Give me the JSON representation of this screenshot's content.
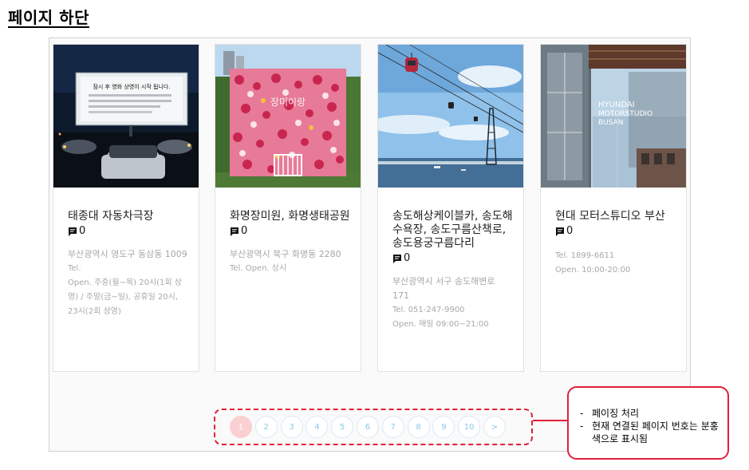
{
  "page": {
    "title": "페이지 하단"
  },
  "cards": [
    {
      "image": "drive-in-theater-photo",
      "name": "태종대 자동차극장",
      "comment_count": "0",
      "address": "부산광역시 영도구 동삼동 1009",
      "info": [
        "Tel.",
        "Open. 주중(월~목) 20시(1회 상영) / 주말(금~일), 공휴일 20시, 23시(2회 상영)"
      ]
    },
    {
      "image": "flower-wall-photo",
      "name": "화명장미원, 화명생태공원",
      "comment_count": "0",
      "address": "부산광역시 북구 화명동 2280",
      "info": [
        "Tel.  Open. 상시"
      ]
    },
    {
      "image": "cable-car-photo",
      "name": "송도해상케이블카, 송도해수욕장, 송도구름산책로, 송도용궁구름다리",
      "comment_count": "0",
      "address": "부산광역시 서구 송도해변로 171",
      "info": [
        "Tel. 051-247-9900",
        "Open. 매일 09:00~21:00"
      ]
    },
    {
      "image": "hyundai-motorstudio-photo",
      "name": "현대 모터스튜디오 부산",
      "comment_count": "0",
      "address": "",
      "info": [
        "Tel. 1899-6611",
        "Open. 10:00-20:00"
      ]
    }
  ],
  "image_text": {
    "screen_line1": "잠시 후 영화 상영이 시작 됩니다.",
    "flower_sign": "장미이랑",
    "building_sign1": "HYUNDAI",
    "building_sign2": "MOTORSTUDIO",
    "building_sign3": "BUSAN"
  },
  "pagination": {
    "pages": [
      "1",
      "2",
      "3",
      "4",
      "5",
      "6",
      "7",
      "8",
      "9",
      "10"
    ],
    "current": "1",
    "next": ">"
  },
  "annotation": {
    "items": [
      "페이징 처리",
      "현재 연결된 페이지 번호는 분홍색으로 표시됨"
    ]
  },
  "colors": {
    "active_page": "#fbd0d2",
    "page_text": "#8cc7e8",
    "annotation_red": "#e0203a"
  }
}
